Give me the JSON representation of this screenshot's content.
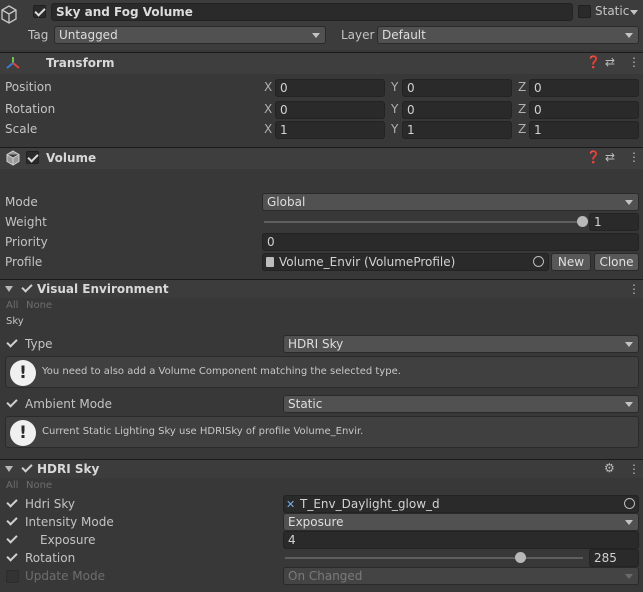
{
  "object": {
    "active": true,
    "name": "Sky and Fog Volume",
    "static_label": "Static",
    "tag_label": "Tag",
    "tag_value": "Untagged",
    "layer_label": "Layer",
    "layer_value": "Default"
  },
  "transform": {
    "title": "Transform",
    "rows": [
      {
        "label": "Position",
        "x": "0",
        "y": "0",
        "z": "0"
      },
      {
        "label": "Rotation",
        "x": "0",
        "y": "0",
        "z": "0"
      },
      {
        "label": "Scale",
        "x": "1",
        "y": "1",
        "z": "1"
      }
    ],
    "axis": {
      "x": "X",
      "y": "Y",
      "z": "Z"
    }
  },
  "volume": {
    "title": "Volume",
    "enabled": true,
    "mode_label": "Mode",
    "mode_value": "Global",
    "weight_label": "Weight",
    "weight_value": "1",
    "weight_fraction": 1.0,
    "priority_label": "Priority",
    "priority_value": "0",
    "profile_label": "Profile",
    "profile_value": "Volume_Envir (VolumeProfile)",
    "new_label": "New",
    "clone_label": "Clone"
  },
  "visual_environment": {
    "title": "Visual Environment",
    "all_label": "All",
    "none_label": "None",
    "sky_section": "Sky",
    "type_label": "Type",
    "type_value": "HDRI Sky",
    "help_1": "You need to also add a Volume Component matching the selected type.",
    "ambient_label": "Ambient Mode",
    "ambient_value": "Static",
    "help_2": "Current Static Lighting Sky use HDRISky of profile Volume_Envir."
  },
  "hdri_sky": {
    "title": "HDRI Sky",
    "all_label": "All",
    "none_label": "None",
    "hdri_label": "Hdri Sky",
    "hdri_value": "T_Env_Daylight_glow_d",
    "intensity_label": "Intensity Mode",
    "intensity_value": "Exposure",
    "exposure_label": "Exposure",
    "exposure_value": "4",
    "rotation_label": "Rotation",
    "rotation_value": "285",
    "rotation_fraction": 0.79,
    "update_label": "Update Mode",
    "update_value": "On Changed"
  },
  "icons": [
    "gameobject-cube-icon",
    "transform-axes-icon",
    "volume-cube-icon",
    "help-icon",
    "preset-icon",
    "kebab-menu-icon",
    "object-picker-icon",
    "texture-icon",
    "profile-asset-icon",
    "warning-icon",
    "settings-gear-icon"
  ]
}
